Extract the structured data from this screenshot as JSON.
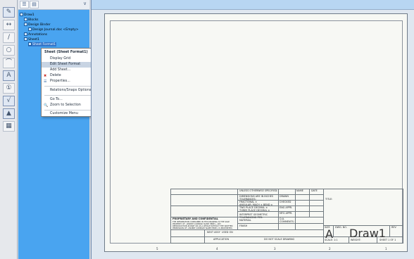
{
  "toolbar": {
    "buttons": [
      {
        "icon": "sketch-icon"
      },
      {
        "icon": "smart-dimension-icon"
      },
      {
        "icon": "line-icon"
      },
      {
        "icon": "circle-icon"
      },
      {
        "icon": "arc-icon"
      },
      {
        "icon": "spline-icon"
      },
      {
        "icon": "centerline-icon"
      },
      {
        "icon": "note-icon"
      },
      {
        "icon": "balloon-icon"
      },
      {
        "icon": "surface-finish-icon"
      },
      {
        "icon": "datum-icon"
      },
      {
        "icon": "table-icon"
      },
      {
        "icon": "view-palette-icon"
      }
    ]
  },
  "tree": {
    "items": [
      {
        "label": "Draw1"
      },
      {
        "label": "Blocks"
      },
      {
        "label": "Design Binder"
      },
      {
        "label": "Design Journal.doc <Empty>"
      },
      {
        "label": "Annotations"
      },
      {
        "label": "Sheet1"
      },
      {
        "label": "Sheet Format1"
      }
    ]
  },
  "context_menu": {
    "header": "Sheet (Sheet Format1)",
    "items": [
      {
        "label": "Display Grid"
      },
      {
        "label": "Edit Sheet Format"
      },
      {
        "label": "Add Sheet..."
      },
      {
        "label": "Delete"
      },
      {
        "label": "Properties..."
      },
      {
        "label": "Relations/Snaps Options..."
      },
      {
        "label": "Go To..."
      },
      {
        "label": "Zoom to Selection"
      },
      {
        "label": "Customize Menu"
      }
    ]
  },
  "title_block": {
    "unless": "UNLESS OTHERWISE SPECIFIED:",
    "name": "NAME",
    "date": "DATE",
    "dims": "DIMENSIONS ARE IN INCHES",
    "tolerances": "TOLERANCES:",
    "fractional": "FRACTIONAL ±",
    "angular": "ANGULAR: MACH ±   BEND ±",
    "two_place": "TWO PLACE DECIMAL ±",
    "three_place": "THREE PLACE DECIMAL ±",
    "interpret": "INTERPRET GEOMETRIC",
    "tolerancing": "TOLERANCING PER:",
    "material": "MATERIAL",
    "finish": "FINISH",
    "drawn": "DRAWN",
    "checked": "CHECKED",
    "eng_appr": "ENG APPR.",
    "mfg_appr": "MFG APPR.",
    "qa": "Q.A.",
    "comments": "COMMENTS:",
    "title": "TITLE:",
    "proprietary": "PROPRIETARY AND CONFIDENTIAL",
    "prop_text": "THE INFORMATION CONTAINED IN THIS DRAWING IS THE SOLE PROPERTY OF <INSERT COMPANY NAME HERE>. ANY REPRODUCTION IN PART OR AS A WHOLE WITHOUT THE WRITTEN PERMISSION OF <INSERT COMPANY NAME HERE> IS PROHIBITED.",
    "next_assy": "NEXT ASSY",
    "used_on": "USED ON",
    "application": "APPLICATION",
    "do_not_scale": "DO NOT SCALE DRAWING",
    "size": "SIZE",
    "dwg_no": "DWG.  NO.",
    "rev": "REV",
    "size_value": "A",
    "drawing_name": "Draw1",
    "scale": "SCALE: 1:1",
    "weight": "WEIGHT:",
    "sheet": "SHEET 1 OF 1"
  },
  "zones": [
    "5",
    "4",
    "3",
    "2",
    "1"
  ]
}
